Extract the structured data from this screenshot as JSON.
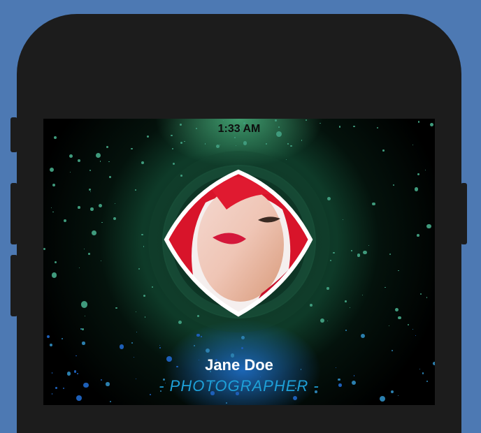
{
  "status_bar": {
    "time": "1:33 AM"
  },
  "profile": {
    "name": "Jane Doe",
    "role": "- PHOTOGRAPHER -"
  },
  "colors": {
    "background": "#4d79b3",
    "phone": "#1c1c1c",
    "accent_role": "#1ea0d8",
    "splatter": "#3f9a7c"
  },
  "icons": {
    "avatar": "profile-photo"
  }
}
